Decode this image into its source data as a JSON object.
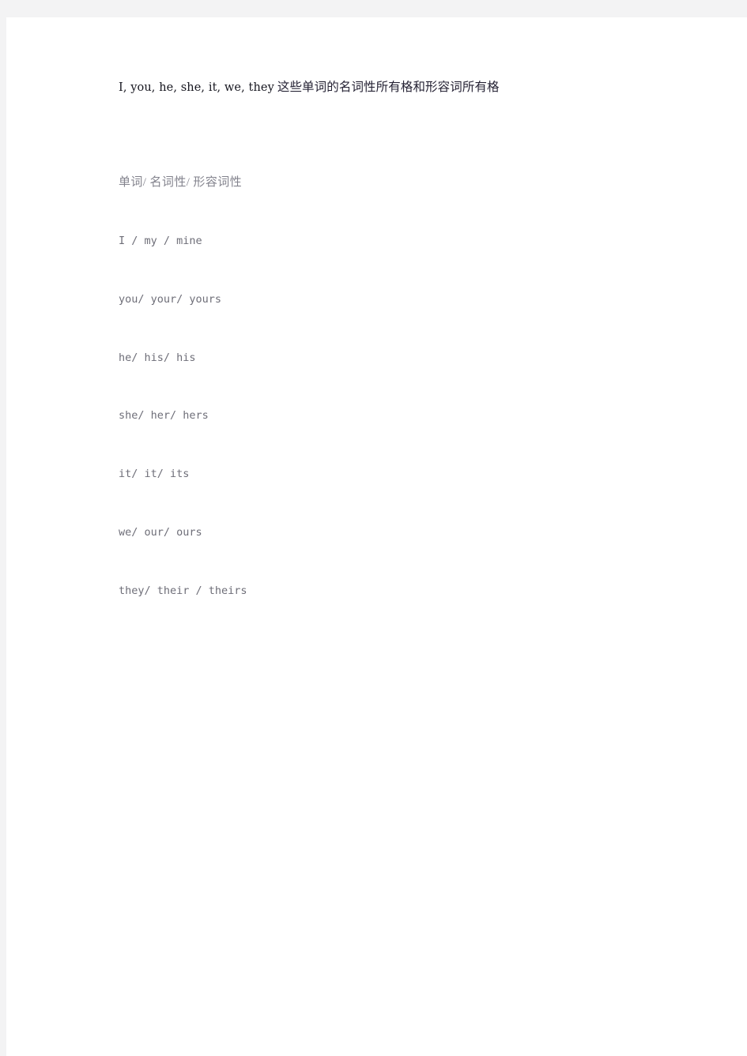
{
  "page": {
    "background_color": "#f3f3f4",
    "sheet_color": "#ffffff"
  },
  "document": {
    "title": {
      "latin_part": "I, you, he, she, it, we, they",
      "han_part": "这些单词的名词性所有格和形容词所有格",
      "full": "I, you, he, she, it, we, they 这些单词的名词性所有格和形容词所有格"
    },
    "table": {
      "header_row": "单词/ 名词性/ 形容词性",
      "columns": [
        "单词",
        "名词性",
        "形容词性"
      ],
      "rows": [
        "I / my / mine",
        "you/ your/ yours",
        "he/ his/ his",
        "she/ her/ hers",
        "it/ it/ its",
        "we/ our/ ours",
        "they/ their / theirs"
      ]
    },
    "colors": {
      "title_text": "#1a1a2e",
      "body_text": "#6e6e78",
      "header_text": "#83838d"
    }
  }
}
